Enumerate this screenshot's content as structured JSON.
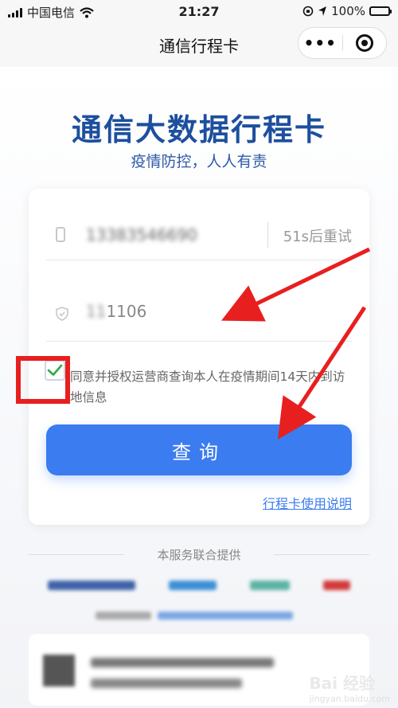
{
  "status_bar": {
    "carrier": "中国电信",
    "time": "21:27",
    "battery": "100%",
    "battery_level": 1.0
  },
  "nav": {
    "title": "通信行程卡",
    "more_icon": "more-dots-icon",
    "close_icon": "target-circle-icon"
  },
  "hero": {
    "title": "通信大数据行程卡",
    "subtitle": "疫情防控，人人有责"
  },
  "form": {
    "phone_value": "13383546690",
    "resend_label": "51s后重试",
    "code_prefix": "11",
    "code_visible": "1106",
    "agreement_text": "同意并授权运营商查询本人在疫情期间14天内到访地信息",
    "agreement_checked": true,
    "query_button": "查询",
    "help_link": "行程卡使用说明"
  },
  "footer": {
    "provided_by": "本服务联合提供"
  },
  "watermark": {
    "brand": "Bai 经验",
    "url": "jingyan.baidu.com"
  },
  "annotation": {
    "box_color": "#e81f1f",
    "arrow_color": "#e81f1f"
  },
  "colors": {
    "primary": "#3b7cf0",
    "title": "#1d4f9e"
  }
}
